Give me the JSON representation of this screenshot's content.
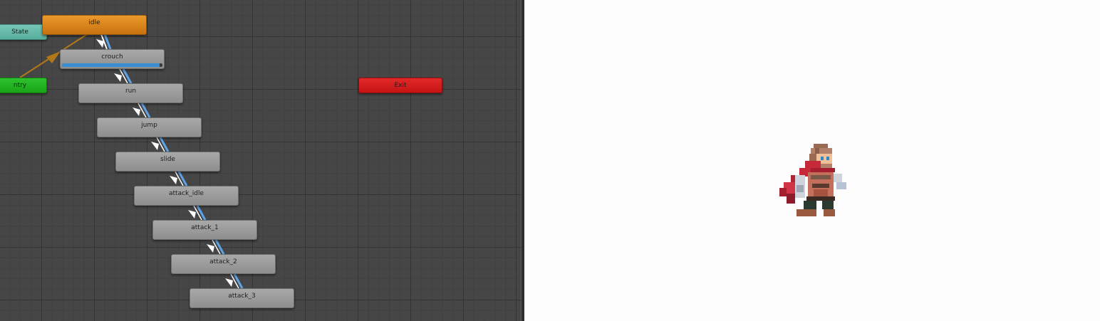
{
  "animator": {
    "states": [
      {
        "id": "any_state",
        "label": "State",
        "kind": "anystate"
      },
      {
        "id": "entry",
        "label": "ntry",
        "kind": "entry"
      },
      {
        "id": "idle",
        "label": "idle",
        "kind": "default"
      },
      {
        "id": "crouch",
        "label": "crouch",
        "kind": "state",
        "active": true,
        "progress": 0.97
      },
      {
        "id": "run",
        "label": "run",
        "kind": "state"
      },
      {
        "id": "jump",
        "label": "jump",
        "kind": "state"
      },
      {
        "id": "slide",
        "label": "slide",
        "kind": "state"
      },
      {
        "id": "attack_idle",
        "label": "attack_idle",
        "kind": "state"
      },
      {
        "id": "attack_1",
        "label": "attack_1",
        "kind": "state"
      },
      {
        "id": "attack_2",
        "label": "attack_2",
        "kind": "state"
      },
      {
        "id": "attack_3",
        "label": "attack_3",
        "kind": "state"
      },
      {
        "id": "exit",
        "label": "Exit",
        "kind": "exit"
      }
    ],
    "transitions": [
      {
        "from": "entry",
        "to": "idle",
        "kind": "default"
      },
      {
        "from": "idle",
        "to": "crouch",
        "kind": "normal",
        "active": true
      },
      {
        "from": "crouch",
        "to": "run",
        "kind": "normal"
      },
      {
        "from": "run",
        "to": "jump",
        "kind": "normal"
      },
      {
        "from": "jump",
        "to": "slide",
        "kind": "normal"
      },
      {
        "from": "slide",
        "to": "attack_idle",
        "kind": "normal"
      },
      {
        "from": "attack_idle",
        "to": "attack_1",
        "kind": "normal"
      },
      {
        "from": "attack_1",
        "to": "attack_2",
        "kind": "normal"
      },
      {
        "from": "attack_2",
        "to": "attack_3",
        "kind": "normal"
      }
    ],
    "colors": {
      "transition_line": "#5fa3e6",
      "transition_arrow": "#ffffff",
      "default_transition": "#b07818",
      "progress": "#3b8ed4"
    }
  },
  "preview": {
    "character_icon": "pixel-art-warrior-icon"
  }
}
